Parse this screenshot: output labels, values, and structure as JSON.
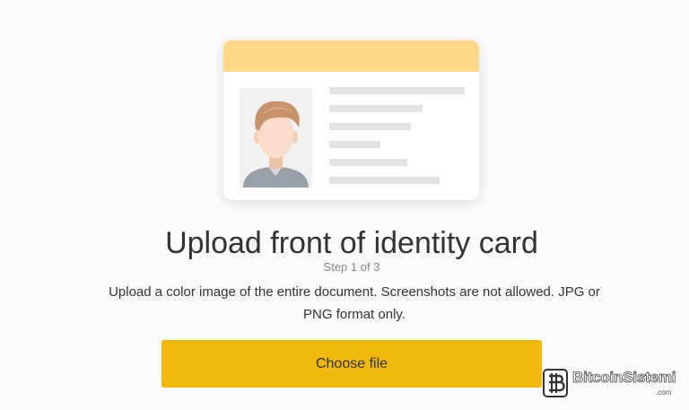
{
  "colors": {
    "accent": "#f0b90b",
    "card_header": "#fdd888",
    "photo_background": "#f1f1f1",
    "info_line": "#e3e3e3"
  },
  "card": {
    "header_icon": "id-card-illustration",
    "photo_icon": "person-avatar-icon"
  },
  "main": {
    "title": "Upload front of identity card",
    "step": "Step 1 of 3",
    "description": "Upload a color image of the entire document. Screenshots are not allowed. JPG or PNG format only.",
    "button_label": "Choose file"
  },
  "watermark": {
    "name": "BitcoinSistemi",
    "domain": ".com",
    "logo_icon": "bitcoin-logo-icon"
  }
}
